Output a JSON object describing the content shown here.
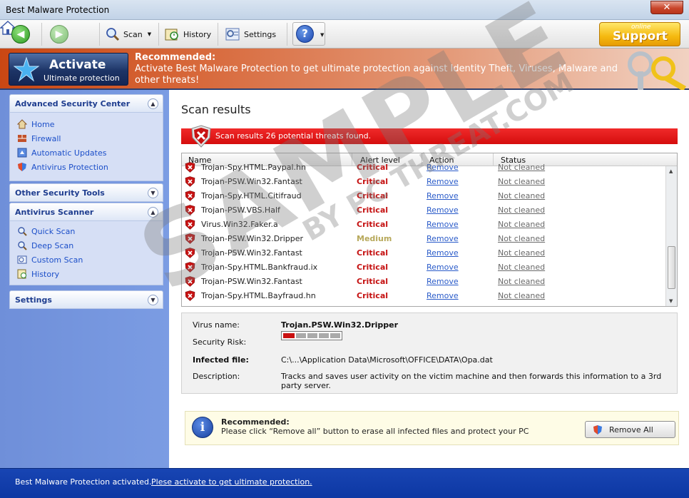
{
  "window": {
    "title": "Best Malware Protection",
    "close_label": "✕"
  },
  "toolbar": {
    "scan_label": "Scan",
    "history_label": "History",
    "settings_label": "Settings",
    "support_online": "online",
    "support_label": "Support"
  },
  "banner": {
    "activate_title": "Activate",
    "activate_sub": "Ultimate protection",
    "rec_title": "Recommended:",
    "rec_text": "Activate Best Malware Protection to get ultimate protection against Identity Theft, Viruses, Malware and other threats!"
  },
  "sidebar": {
    "advanced_title": "Advanced Security Center",
    "advanced_items": [
      {
        "label": "Home",
        "icon": "home-icon"
      },
      {
        "label": "Firewall",
        "icon": "firewall-icon"
      },
      {
        "label": "Automatic Updates",
        "icon": "updates-icon"
      },
      {
        "label": "Antivirus Protection",
        "icon": "shield-icon"
      }
    ],
    "other_tools_title": "Other Security Tools",
    "antivirus_title": "Antivirus Scanner",
    "antivirus_items": [
      {
        "label": "Quick Scan",
        "icon": "magnifier-icon"
      },
      {
        "label": "Deep Scan",
        "icon": "magnifier-icon"
      },
      {
        "label": "Custom Scan",
        "icon": "custom-scan-icon"
      },
      {
        "label": "History",
        "icon": "history-icon"
      }
    ],
    "settings_title": "Settings"
  },
  "main": {
    "title": "Scan results",
    "alert_text": "Scan results 26 potential threats found.",
    "columns": [
      "Name",
      "Alert level",
      "Action",
      "Status"
    ],
    "rows": [
      {
        "name": "Trojan-Spy.HTML.Paypal.hn",
        "alert": "Critical",
        "action": "Remove",
        "status": "Not cleaned"
      },
      {
        "name": "Trojan-PSW.Win32.Fantast",
        "alert": "Critical",
        "action": "Remove",
        "status": "Not cleaned"
      },
      {
        "name": "Trojan-Spy.HTML.Citifraud",
        "alert": "Critical",
        "action": "Remove",
        "status": "Not cleaned"
      },
      {
        "name": "Trojan-PSW.VBS.Half",
        "alert": "Critical",
        "action": "Remove",
        "status": "Not cleaned"
      },
      {
        "name": "Virus.Win32.Faker.a",
        "alert": "Critical",
        "action": "Remove",
        "status": "Not cleaned"
      },
      {
        "name": "Trojan-PSW.Win32.Dripper",
        "alert": "Medium",
        "action": "Remove",
        "status": "Not cleaned"
      },
      {
        "name": "Trojan-PSW.Win32.Fantast",
        "alert": "Critical",
        "action": "Remove",
        "status": "Not cleaned"
      },
      {
        "name": "Trojan-Spy.HTML.Bankfraud.ix",
        "alert": "Critical",
        "action": "Remove",
        "status": "Not cleaned"
      },
      {
        "name": "Trojan-PSW.Win32.Fantast",
        "alert": "Critical",
        "action": "Remove",
        "status": "Not cleaned"
      },
      {
        "name": "Trojan-Spy.HTML.Bayfraud.hn",
        "alert": "Critical",
        "action": "Remove",
        "status": "Not cleaned"
      }
    ],
    "details": {
      "virus_name_label": "Virus name:",
      "virus_name": "Trojan.PSW.Win32.Dripper",
      "risk_label": "Security Risk:",
      "risk_level": 0.2,
      "file_label": "Infected file:",
      "file_value": "C:\\...\\Application Data\\Microsoft\\OFFICE\\DATA\\Opa.dat",
      "desc_label": "Description:",
      "desc_value": "Tracks and saves user activity on the victim machine and then forwards this information to a 3rd party server."
    },
    "recommend": {
      "title": "Recommended:",
      "text": "Please click “Remove all” button to erase all infected files and protect your PC",
      "button": "Remove All"
    }
  },
  "status": {
    "activated": "Best Malware Protection activated.",
    "link": "Plese activate to get ultimate protection."
  },
  "watermark": {
    "line1": "SAMPLE",
    "line2": "BY PC THREAT.COM"
  },
  "colors": {
    "critical": "#c51212",
    "medium": "#b7a85a",
    "alert_bar": "#e01717",
    "status_bar": "#1540ab"
  }
}
